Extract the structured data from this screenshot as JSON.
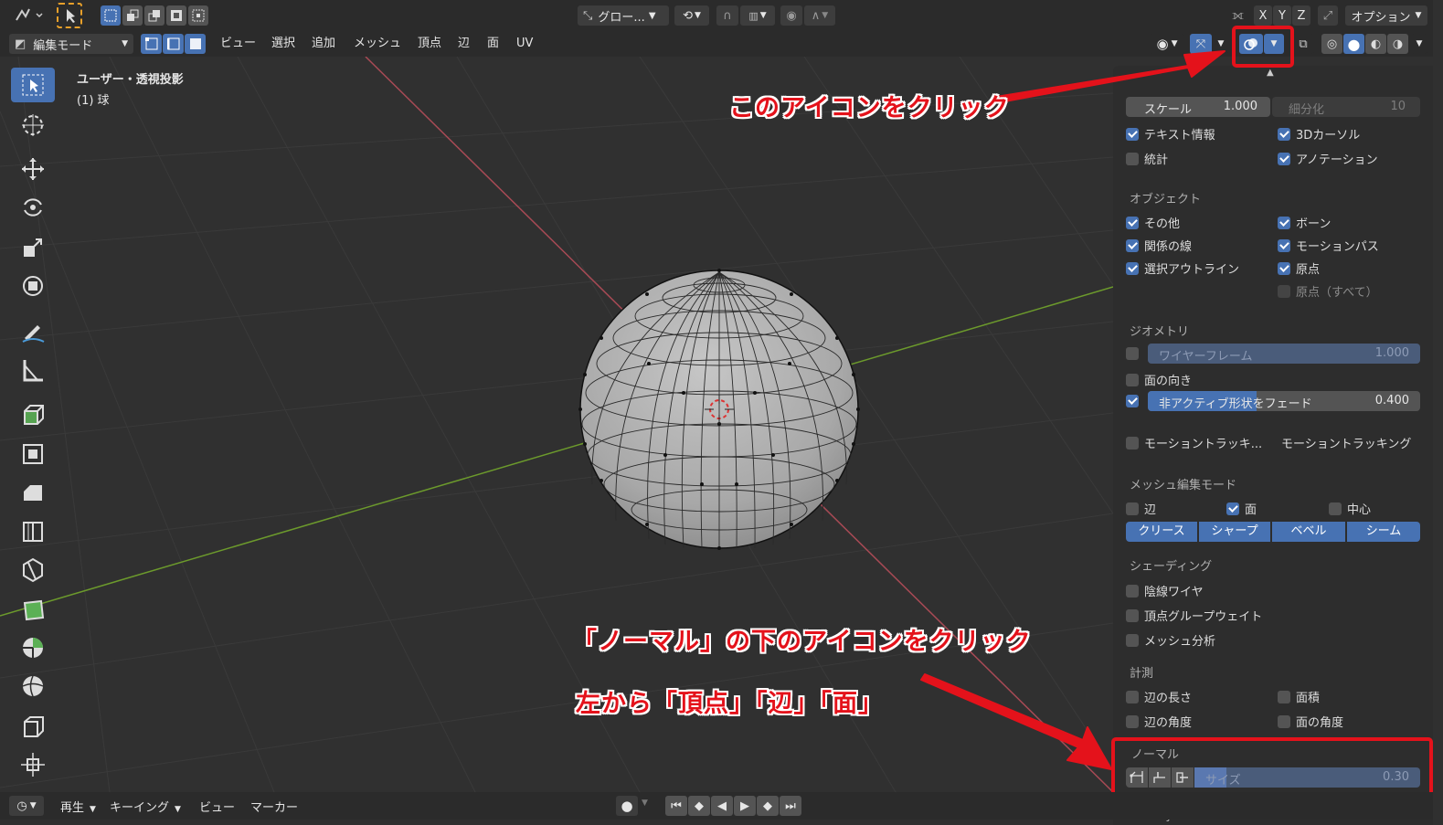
{
  "top_bar": {
    "pivot_label": "グロー...",
    "axis_x": "X",
    "axis_y": "Y",
    "axis_z": "Z",
    "options_label": "オプション"
  },
  "header": {
    "mode_label": "編集モード",
    "menus": [
      "ビュー",
      "選択",
      "追加",
      "メッシュ",
      "頂点",
      "辺",
      "面",
      "UV"
    ]
  },
  "viewport": {
    "view_name": "ユーザー・透視投影",
    "object_name": "(1) 球"
  },
  "overlay_panel": {
    "scale_label": "スケール",
    "scale_value": "1.000",
    "subdiv_label": "細分化",
    "subdiv_value": "10",
    "text_info": "テキスト情報",
    "cursor_3d": "3Dカーソル",
    "stats": "統計",
    "annotation": "アノテーション",
    "objects_header": "オブジェクト",
    "extras": "その他",
    "bones": "ボーン",
    "relationship_lines": "関係の線",
    "motion_paths": "モーションパス",
    "outline_selected": "選択アウトライン",
    "origins": "原点",
    "origins_all": "原点（すべて）",
    "geometry_header": "ジオメトリ",
    "wireframe_label": "ワイヤーフレーム",
    "wireframe_value": "1.000",
    "face_orientation": "面の向き",
    "fade_inactive_label": "非アクティブ形状をフェード",
    "fade_inactive_value": "0.400",
    "fade_inactive_fraction": 0.4,
    "motion_tracking": "モーショントラッキ...",
    "motion_tracking_label": "モーショントラッキング",
    "mesh_edit_header": "メッシュ編集モード",
    "edges": "辺",
    "faces": "面",
    "center": "中心",
    "crease": "クリース",
    "sharp": "シャープ",
    "bevel": "ベベル",
    "seam": "シーム",
    "shading_header": "シェーディング",
    "hidden_wire": "陰線ワイヤ",
    "vertex_group_weights": "頂点グループウェイト",
    "mesh_analysis": "メッシュ分析",
    "measurement_header": "計測",
    "edge_length": "辺の長さ",
    "face_area": "面積",
    "edge_angle": "辺の角度",
    "face_angle": "面の角度",
    "normals_header": "ノーマル",
    "normal_size_label": "サイズ",
    "normal_size_value": "0.30",
    "normal_size_fraction": 0.03,
    "freestyle_header": "Freestyle"
  },
  "annotations": {
    "click_icon": "このアイコンをクリック",
    "click_below_normal": "「ノーマル」の下のアイコンをクリック",
    "order_from_left": "左から「頂点」「辺」「面」"
  },
  "timeline": {
    "playback": "再生",
    "keying": "キーイング",
    "view": "ビュー",
    "marker": "マーカー"
  },
  "colors": {
    "accent": "#4772b3",
    "annotation_red": "#e4121b",
    "x_axis": "#a84a55",
    "y_axis": "#6c9a2c"
  }
}
